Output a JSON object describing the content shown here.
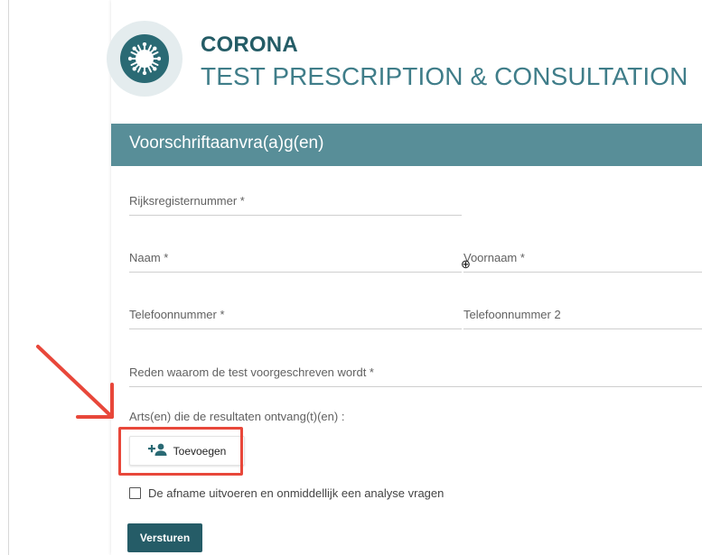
{
  "brand": {
    "title": "CORONA",
    "subtitle": "TEST PRESCRIPTION & CONSULTATION"
  },
  "form": {
    "header": "Voorschriftaanvra(a)g(en)",
    "fields": {
      "national_number": "Rijksregisternummer *",
      "last_name": "Naam *",
      "first_name": "Voornaam *",
      "phone": "Telefoonnummer *",
      "phone2": "Telefoonnummer 2",
      "reason": "Reden waarom de test voorgeschreven wordt *"
    },
    "doctors_label": "Arts(en) die de resultaten ontvang(t)(en) :",
    "add_button": "Toevoegen",
    "checkbox_label": "De afname uitvoeren en onmiddellijk een analyse vragen",
    "submit_button": "Versturen"
  },
  "colors": {
    "brand_dark": "#245c66",
    "brand_light": "#3f7d89",
    "header_bg": "#588e98",
    "annotation_red": "#e8473a"
  },
  "icons": [
    "virus-icon",
    "add-person-icon",
    "move-cursor-icon",
    "arrow-annotation"
  ]
}
